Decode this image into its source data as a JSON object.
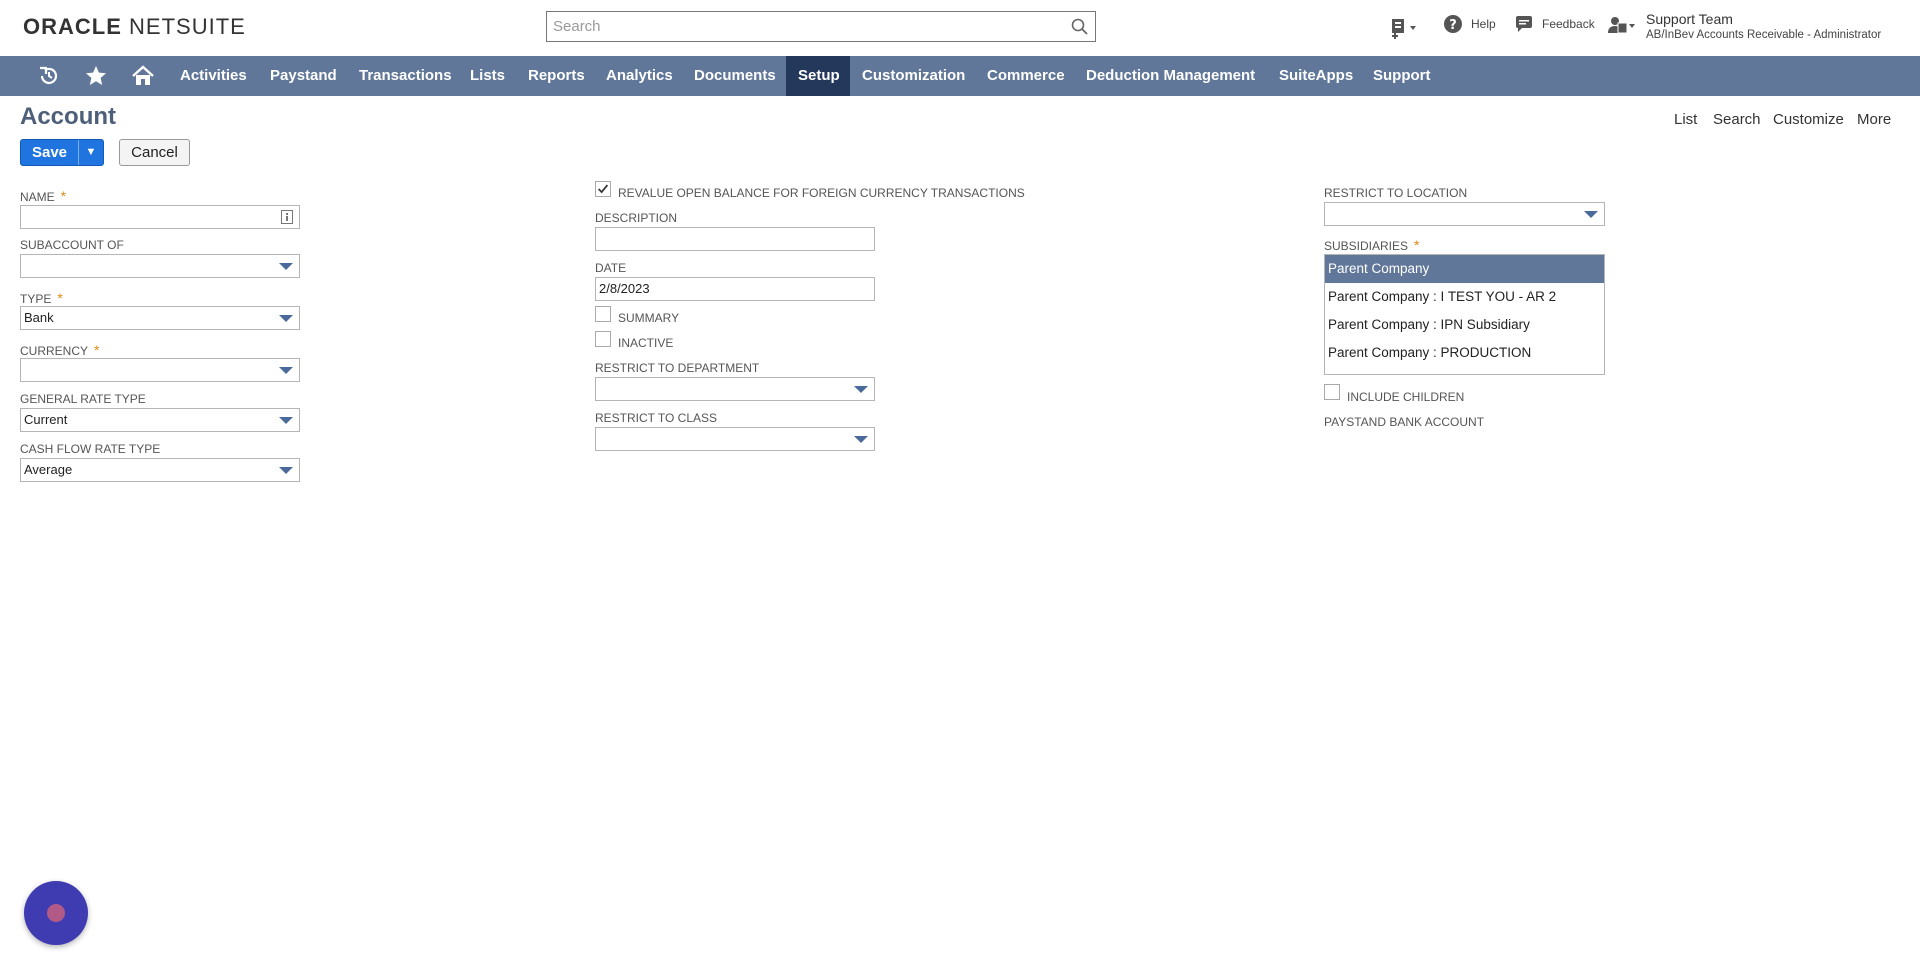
{
  "header": {
    "logo_part1": "ORACLE",
    "logo_part2": "NETSUITE",
    "search_placeholder": "Search",
    "help_label": "Help",
    "feedback_label": "Feedback",
    "user_name": "Support Team",
    "user_role": "AB/InBev Accounts Receivable - Administrator"
  },
  "nav": {
    "items": [
      {
        "label": "Activities"
      },
      {
        "label": "Paystand"
      },
      {
        "label": "Transactions"
      },
      {
        "label": "Lists"
      },
      {
        "label": "Reports"
      },
      {
        "label": "Analytics"
      },
      {
        "label": "Documents"
      },
      {
        "label": "Setup",
        "active": true
      },
      {
        "label": "Customization"
      },
      {
        "label": "Commerce"
      },
      {
        "label": "Deduction Management"
      },
      {
        "label": "SuiteApps"
      },
      {
        "label": "Support"
      }
    ]
  },
  "page": {
    "title": "Account",
    "links": {
      "list": "List",
      "search": "Search",
      "customize": "Customize",
      "more": "More"
    },
    "save_label": "Save",
    "cancel_label": "Cancel"
  },
  "form": {
    "name": {
      "label": "Name",
      "value": ""
    },
    "subaccount_of": {
      "label": "Subaccount of",
      "value": ""
    },
    "type": {
      "label": "Type",
      "value": "Bank"
    },
    "currency": {
      "label": "Currency",
      "value": ""
    },
    "general_rate_type": {
      "label": "General Rate Type",
      "value": "Current"
    },
    "cash_flow_rate_type": {
      "label": "Cash Flow Rate Type",
      "value": "Average"
    },
    "revalue": {
      "label": "Revalue open balance for foreign currency transactions",
      "checked": true
    },
    "description": {
      "label": "Description",
      "value": ""
    },
    "date": {
      "label": "Date",
      "value": "2/8/2023"
    },
    "summary": {
      "label": "Summary",
      "checked": false
    },
    "inactive": {
      "label": "Inactive",
      "checked": false
    },
    "restrict_department": {
      "label": "Restrict to Department",
      "value": ""
    },
    "restrict_class": {
      "label": "Restrict to Class",
      "value": ""
    },
    "restrict_location": {
      "label": "Restrict to Location",
      "value": ""
    },
    "subsidiaries": {
      "label": "Subsidiaries",
      "options": [
        {
          "label": "Parent Company",
          "selected": true
        },
        {
          "label": "Parent Company : I TEST YOU - AR 2",
          "selected": false
        },
        {
          "label": "Parent Company : IPN Subsidiary",
          "selected": false
        },
        {
          "label": "Parent Company : PRODUCTION",
          "selected": false
        }
      ]
    },
    "include_children": {
      "label": "Include Children",
      "checked": false
    },
    "paystand_bank_account": {
      "label": "Paystand Bank Account"
    }
  },
  "colors": {
    "nav_bg": "#607799",
    "nav_active": "#24385b",
    "save_btn": "#1f74e0",
    "required_star": "#e08a14",
    "chat_bubble": "#3f3bb1"
  }
}
